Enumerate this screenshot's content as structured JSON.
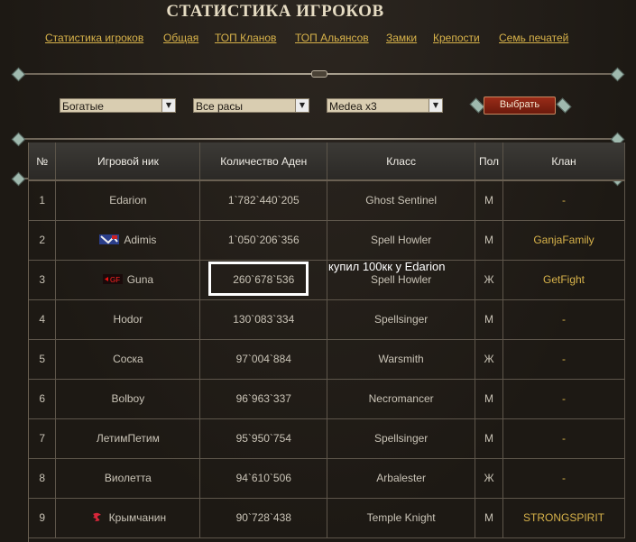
{
  "page": {
    "title": "СТАТИСТИКА ИГРОКОВ"
  },
  "nav": [
    {
      "label": "Статистика игроков"
    },
    {
      "label": "Общая"
    },
    {
      "label": "ТОП Кланов"
    },
    {
      "label": "ТОП Альянсов"
    },
    {
      "label": "Замки"
    },
    {
      "label": "Крепости"
    },
    {
      "label": "Семь печатей"
    }
  ],
  "filters": {
    "category": "Богатые",
    "race": "Все расы",
    "server": "Medea x3",
    "submit_label": "Выбрать"
  },
  "table": {
    "headers": [
      "№",
      "Игровой ник",
      "Количество Аден",
      "Класс",
      "Пол",
      "Клан"
    ],
    "rows": [
      {
        "n": "1",
        "nick": "Edarion",
        "adena": "1`782`440`205",
        "class": "Ghost Sentinel",
        "sex": "М",
        "clan": "-",
        "crest": null
      },
      {
        "n": "2",
        "nick": "Adimis",
        "adena": "1`050`206`356",
        "class": "Spell Howler",
        "sex": "М",
        "clan": "GanjaFamily",
        "crest": "ganjafamily-crest"
      },
      {
        "n": "3",
        "nick": "Guna",
        "adena": "260`678`536",
        "class": "Spell Howler",
        "sex": "Ж",
        "clan": "GetFight",
        "crest": "getfight-crest"
      },
      {
        "n": "4",
        "nick": "Hodor",
        "adena": "130`083`334",
        "class": "Spellsinger",
        "sex": "М",
        "clan": "-",
        "crest": null
      },
      {
        "n": "5",
        "nick": "Соска",
        "adena": "97`004`884",
        "class": "Warsmith",
        "sex": "Ж",
        "clan": "-",
        "crest": null
      },
      {
        "n": "6",
        "nick": "Bolboy",
        "adena": "96`963`337",
        "class": "Necromancer",
        "sex": "М",
        "clan": "-",
        "crest": null
      },
      {
        "n": "7",
        "nick": "ЛетимПетим",
        "adena": "95`950`754",
        "class": "Spellsinger",
        "sex": "М",
        "clan": "-",
        "crest": null
      },
      {
        "n": "8",
        "nick": "Виолетта",
        "adena": "94`610`506",
        "class": "Arbalester",
        "sex": "Ж",
        "clan": "-",
        "crest": null
      },
      {
        "n": "9",
        "nick": "Крымчанин",
        "adena": "90`728`438",
        "class": "Temple Knight",
        "sex": "М",
        "clan": "STRONGSPIRIT",
        "crest": "strongspirit-crest"
      }
    ]
  },
  "annotation": {
    "text": "купил 100кк у Edarion"
  },
  "colors": {
    "link": "#d7b24a",
    "background": "#241f19",
    "button": "#8a2414"
  }
}
